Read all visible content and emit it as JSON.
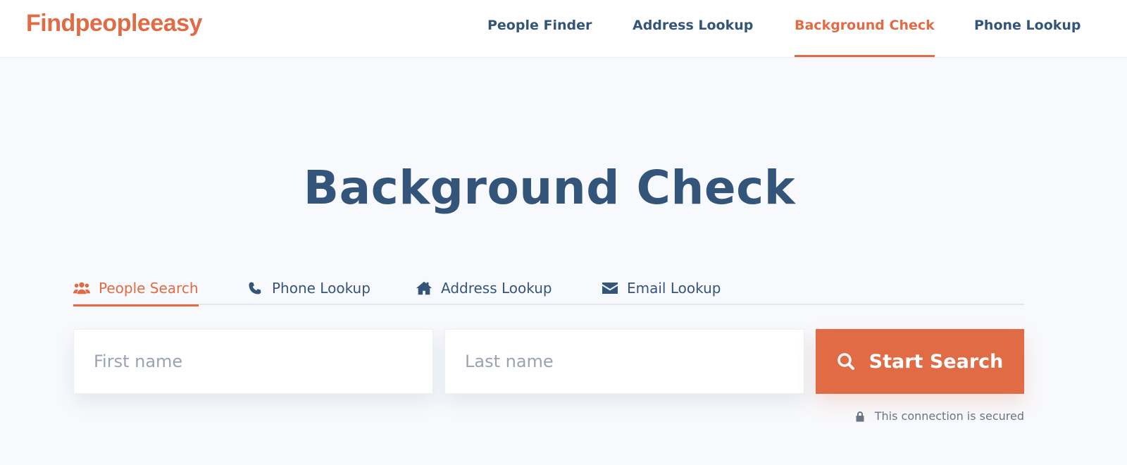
{
  "brand": {
    "logo_text": "Findpeopleeasy",
    "accent_color": "#e06b45",
    "text_color": "#34557a"
  },
  "nav": {
    "items": [
      {
        "label": "People Finder",
        "active": false
      },
      {
        "label": "Address Lookup",
        "active": false
      },
      {
        "label": "Background Check",
        "active": true
      },
      {
        "label": "Phone Lookup",
        "active": false
      }
    ]
  },
  "main": {
    "title": "Background Check",
    "tabs": [
      {
        "label": "People Search",
        "icon": "people-icon",
        "active": true
      },
      {
        "label": "Phone Lookup",
        "icon": "phone-icon",
        "active": false
      },
      {
        "label": "Address Lookup",
        "icon": "home-icon",
        "active": false
      },
      {
        "label": "Email Lookup",
        "icon": "envelope-icon",
        "active": false
      }
    ],
    "form": {
      "first_name_placeholder": "First name",
      "last_name_placeholder": "Last name",
      "first_name_value": "",
      "last_name_value": "",
      "submit_label": "Start Search",
      "submit_icon": "search-icon"
    },
    "secure_note": "This connection is secured",
    "secure_icon": "lock-icon"
  }
}
